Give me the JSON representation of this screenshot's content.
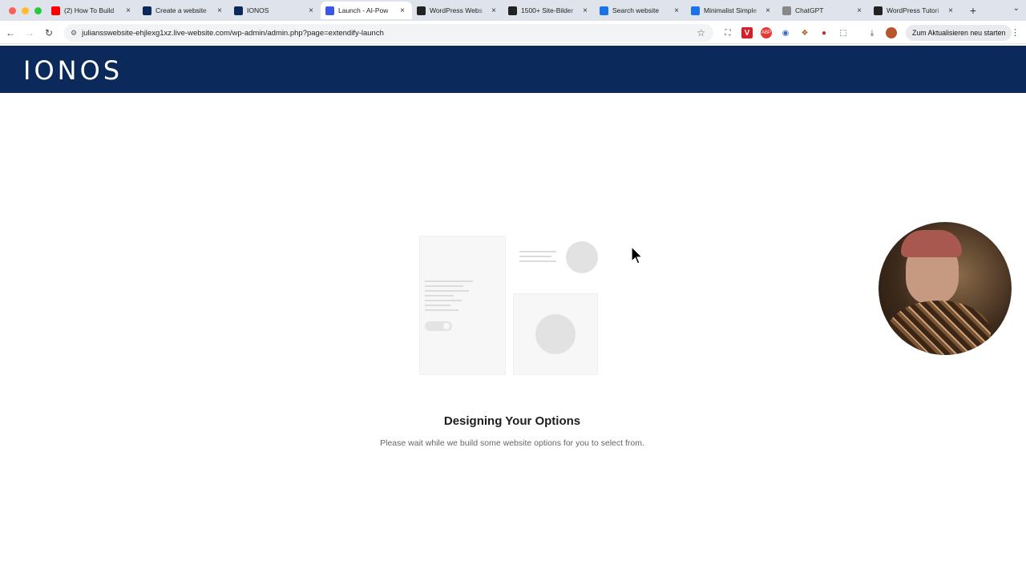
{
  "browser": {
    "tabs": [
      {
        "title": "(2) How To Build",
        "favicon": "youtube-icon",
        "color": "#ff0000",
        "active": false
      },
      {
        "title": "Create a website",
        "favicon": "ionos-icon",
        "color": "#0b2a5b",
        "active": false
      },
      {
        "title": "IONOS",
        "favicon": "ionos-icon",
        "color": "#0b2a5b",
        "active": false
      },
      {
        "title": "Launch - AI-Pow",
        "favicon": "wordpress-icon",
        "color": "#3858e9",
        "active": true
      },
      {
        "title": "WordPress Webs",
        "favicon": "notion-icon",
        "color": "#222222",
        "active": false
      },
      {
        "title": "1500+ Site-Bilder",
        "favicon": "building-icon",
        "color": "#222222",
        "active": false
      },
      {
        "title": "Search website",
        "favicon": "search-c-icon",
        "color": "#1a73e8",
        "active": false
      },
      {
        "title": "Minimalist Simple",
        "favicon": "search-c-icon",
        "color": "#1a73e8",
        "active": false
      },
      {
        "title": "ChatGPT",
        "favicon": "chatgpt-icon",
        "color": "#888888",
        "active": false
      },
      {
        "title": "WordPress Tutori",
        "favicon": "notion-icon",
        "color": "#222222",
        "active": false
      }
    ],
    "new_tab": "+",
    "close": "×",
    "url": "juliansswebsite-ehjlexg1xz.live-website.com/wp-admin/admin.php?page=extendify-launch",
    "update_button": "Zum Aktualisieren neu starten"
  },
  "header": {
    "logo": "IONOS",
    "bg": "#0b2a5b"
  },
  "main": {
    "headline": "Designing Your Options",
    "subline": "Please wait while we build some website options for you to select from."
  }
}
